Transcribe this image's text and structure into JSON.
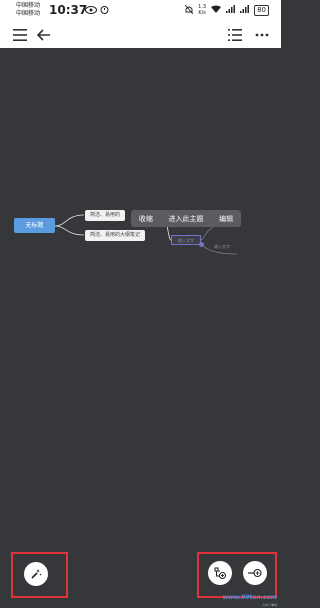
{
  "status_bar": {
    "carrier1": "中国移动",
    "carrier2": "中国移动",
    "time": "10:37",
    "net_speed_value": "1.3",
    "net_speed_unit": "K/s",
    "battery": "80"
  },
  "mindmap": {
    "root": "无标题",
    "children": [
      "简洁、易用的",
      "简洁、易用的大纲笔记"
    ],
    "selected_node": "输入文字",
    "ghost_labels": [
      "输入文字",
      "输入文字"
    ]
  },
  "context_menu": {
    "items": [
      "收缩",
      "进入此主题",
      "编辑"
    ]
  },
  "watermark": {
    "logo_text": "www.99ton.com",
    "sub_text": "久友下载站"
  },
  "colors": {
    "canvas_bg": "#35373b",
    "root_node": "#5b9be0",
    "highlight": "#e0333c",
    "selection": "#7a72c8"
  }
}
